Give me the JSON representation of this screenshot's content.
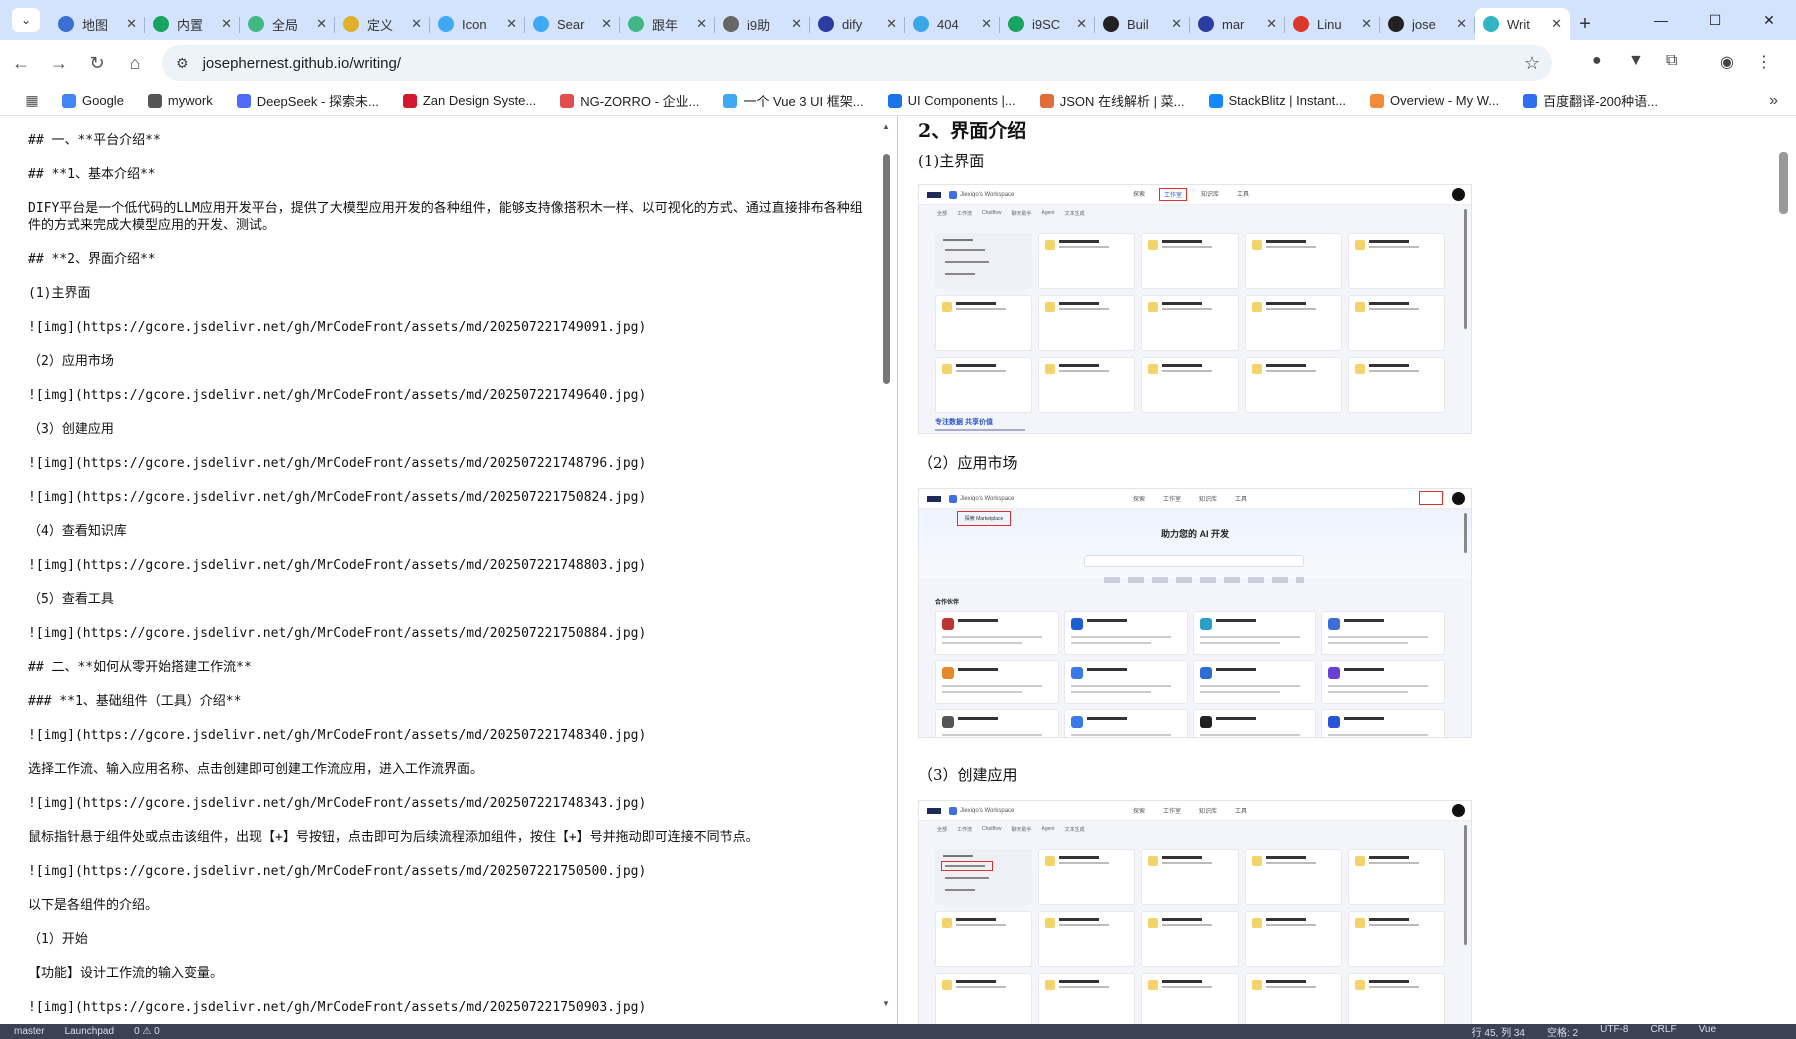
{
  "tabs": [
    {
      "label": "地图",
      "color": "#3b6fd6",
      "icon": "globe-icon"
    },
    {
      "label": "内置",
      "color": "#1aa260",
      "icon": "v-logo-icon"
    },
    {
      "label": "全局",
      "color": "#41b883",
      "icon": "vue-logo-icon"
    },
    {
      "label": "定义",
      "color": "#e0b02a",
      "icon": "smiley-icon"
    },
    {
      "label": "Icon",
      "color": "#3fa9f5",
      "icon": "globe-icon"
    },
    {
      "label": "Sear",
      "color": "#3fa9f5",
      "icon": "globe-icon"
    },
    {
      "label": "跟年",
      "color": "#41b883",
      "icon": "vue-logo-icon"
    },
    {
      "label": "i9助",
      "color": "#666666",
      "icon": "globe-icon"
    },
    {
      "label": "dify",
      "color": "#2a3c9e",
      "icon": "paw-icon"
    },
    {
      "label": "404",
      "color": "#3aa7e8",
      "icon": "pencil-icon"
    },
    {
      "label": "i9SC",
      "color": "#1aa260",
      "icon": "green-icon"
    },
    {
      "label": "Buil",
      "color": "#222222",
      "icon": "search-icon"
    },
    {
      "label": "mar",
      "color": "#2a3c9e",
      "icon": "paw-icon"
    },
    {
      "label": "Linu",
      "color": "#d9382b",
      "icon": "c-logo-icon"
    },
    {
      "label": "jose",
      "color": "#222222",
      "icon": "github-icon"
    },
    {
      "label": "Writ",
      "color": "#2fb5c4",
      "icon": "w-logo-icon",
      "active": true
    }
  ],
  "window": {
    "minimize": "—",
    "maximize": "☐",
    "close": "✕"
  },
  "toolbar": {
    "url": "josephernest.github.io/writing/"
  },
  "bookmarks": [
    {
      "label": "Google",
      "color": "#4285f4"
    },
    {
      "label": "mywork",
      "color": "#555555"
    },
    {
      "label": "DeepSeek - 探索未...",
      "color": "#4d6bfe"
    },
    {
      "label": "Zan Design Syste...",
      "color": "#d4182f"
    },
    {
      "label": "NG-ZORRO - 企业...",
      "color": "#e14e4e"
    },
    {
      "label": "一个 Vue 3 UI 框架...",
      "color": "#3fa9f5"
    },
    {
      "label": "UI Components |...",
      "color": "#1a73e8"
    },
    {
      "label": "JSON 在线解析 | 菜...",
      "color": "#e06c3c"
    },
    {
      "label": "StackBlitz | Instant...",
      "color": "#1389fd"
    },
    {
      "label": "Overview - My W...",
      "color": "#f08c3c"
    },
    {
      "label": "百度翻译-200种语...",
      "color": "#2e6ef0"
    }
  ],
  "editor": {
    "lines": [
      "## 一、**平台介绍**",
      "## **1、基本介绍**",
      "DIFY平台是一个低代码的LLM应用开发平台，提供了大模型应用开发的各种组件，能够支持像搭积木一样、以可视化的方式、通过直接排布各种组件的方式来完成大模型应用的开发、测试。",
      "## **2、界面介绍**",
      "(1)主界面",
      "![img](https://gcore.jsdelivr.net/gh/MrCodeFront/assets/md/202507221749091.jpg)",
      "（2）应用市场",
      "![img](https://gcore.jsdelivr.net/gh/MrCodeFront/assets/md/202507221749640.jpg)",
      "（3）创建应用",
      "![img](https://gcore.jsdelivr.net/gh/MrCodeFront/assets/md/202507221748796.jpg)",
      "![img](https://gcore.jsdelivr.net/gh/MrCodeFront/assets/md/202507221750824.jpg)",
      "（4）查看知识库",
      "![img](https://gcore.jsdelivr.net/gh/MrCodeFront/assets/md/202507221748803.jpg)",
      "（5）查看工具",
      "![img](https://gcore.jsdelivr.net/gh/MrCodeFront/assets/md/202507221750884.jpg)",
      "## 二、**如何从零开始搭建工作流**",
      "### **1、基础组件（工具）介绍**",
      "![img](https://gcore.jsdelivr.net/gh/MrCodeFront/assets/md/202507221748340.jpg)",
      "选择工作流、输入应用名称、点击创建即可创建工作流应用，进入工作流界面。",
      "![img](https://gcore.jsdelivr.net/gh/MrCodeFront/assets/md/202507221748343.jpg)",
      "鼠标指针悬于组件处或点击该组件，出现【+】号按钮，点击即可为后续流程添加组件，按住【+】号并拖动即可连接不同节点。",
      "![img](https://gcore.jsdelivr.net/gh/MrCodeFront/assets/md/202507221750500.jpg)",
      "以下是各组件的介绍。",
      "（1）开始",
      "【功能】设计工作流的输入变量。",
      "![img](https://gcore.jsdelivr.net/gh/MrCodeFront/assets/md/202507221750903.jpg)"
    ]
  },
  "preview": {
    "heading": "2、界面介绍",
    "captions": [
      "(1)主界面",
      "（2）应用市场",
      "（3）创建应用"
    ],
    "shot": {
      "workspace": "Jiexiqo's Workspace",
      "nav": [
        "探索",
        "工作室",
        "知识库",
        "工具"
      ],
      "filters": [
        "全部",
        "工作流",
        "Chatflow",
        "聊天助手",
        "Agent",
        "文本生成"
      ],
      "footer": "专注数据 共享价值",
      "marketplace": "探索 Marketplace",
      "hero": "助力您的 AI 开发",
      "section": "合作伙伴",
      "plugin": "插件"
    }
  },
  "status": {
    "left": [
      "master",
      "Launchpad",
      "0 ⚠ 0"
    ],
    "right": [
      "行 45, 列 34",
      "空格: 2",
      "UTF-8",
      "CRLF",
      "Vue"
    ]
  }
}
